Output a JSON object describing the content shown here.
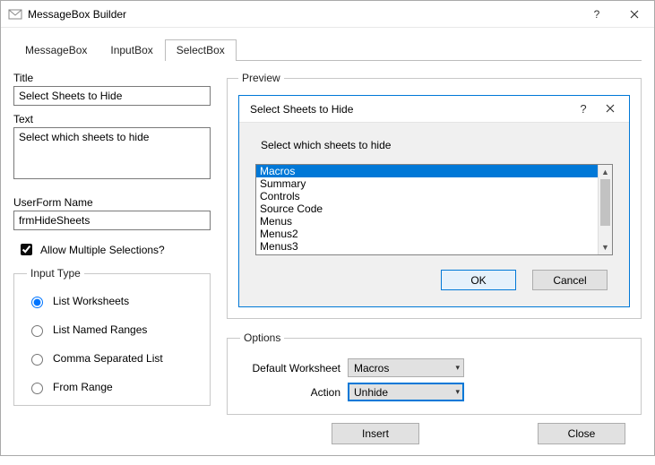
{
  "window": {
    "title": "MessageBox Builder"
  },
  "tabs": {
    "items": [
      {
        "label": "MessageBox"
      },
      {
        "label": "InputBox"
      },
      {
        "label": "SelectBox"
      }
    ],
    "active_index": 2
  },
  "left_panel": {
    "title_label": "Title",
    "title_value": "Select Sheets to Hide",
    "text_label": "Text",
    "text_value": "Select which sheets to hide",
    "userform_label": "UserForm Name",
    "userform_value": "frmHideSheets",
    "allow_multi_label": "Allow Multiple Selections?",
    "allow_multi_checked": true,
    "input_type_legend": "Input Type",
    "input_type_options": [
      "List Worksheets",
      "List Named Ranges",
      "Comma Separated List",
      "From Range"
    ],
    "input_type_selected": 0
  },
  "preview": {
    "legend": "Preview",
    "dialog_title": "Select Sheets to Hide",
    "dialog_text": "Select which sheets to hide",
    "list_items": [
      "Macros",
      "Summary",
      "Controls",
      "Source Code",
      "Menus",
      "Menus2",
      "Menus3"
    ],
    "selected_index": 0,
    "ok_label": "OK",
    "cancel_label": "Cancel"
  },
  "options": {
    "legend": "Options",
    "default_ws_label": "Default Worksheet",
    "default_ws_value": "Macros",
    "action_label": "Action",
    "action_value": "Unhide"
  },
  "footer": {
    "insert_label": "Insert",
    "close_label": "Close"
  }
}
